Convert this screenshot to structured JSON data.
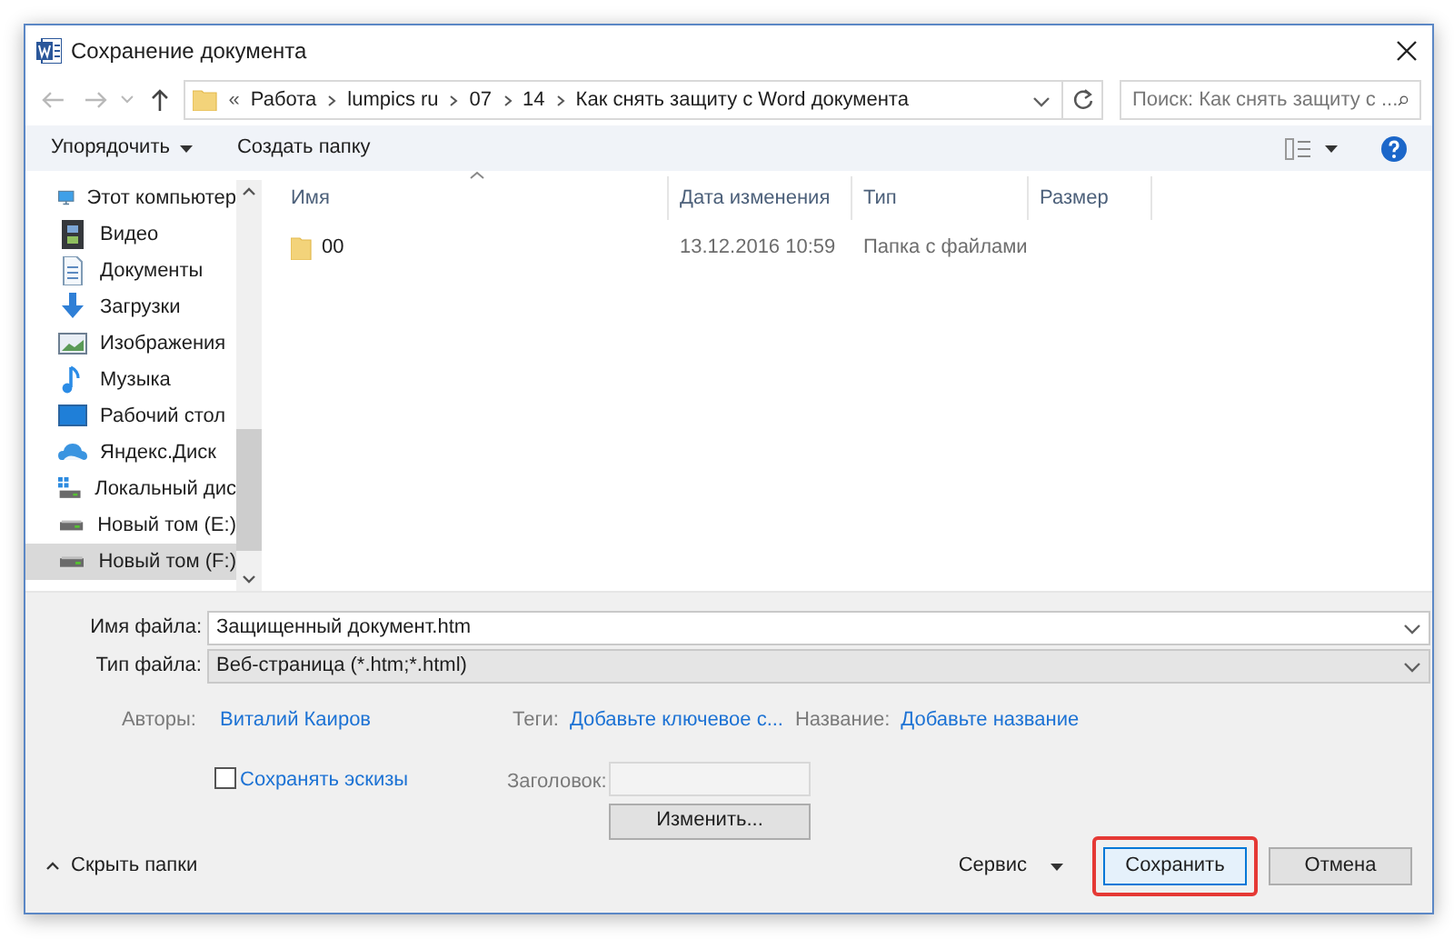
{
  "window": {
    "title": "Сохранение документа"
  },
  "address": {
    "prefix": "«",
    "segments": [
      "Работа",
      "lumpics ru",
      "07",
      "14",
      "Как снять защиту с Word документа"
    ]
  },
  "search": {
    "placeholder": "Поиск: Как снять защиту с ..."
  },
  "toolbar": {
    "organize": "Упорядочить",
    "new_folder": "Создать папку"
  },
  "sidebar": {
    "items": [
      {
        "label": "Этот компьютер",
        "kind": "computer",
        "selected": false
      },
      {
        "label": "Видео",
        "kind": "video",
        "selected": false
      },
      {
        "label": "Документы",
        "kind": "documents",
        "selected": false
      },
      {
        "label": "Загрузки",
        "kind": "downloads",
        "selected": false
      },
      {
        "label": "Изображения",
        "kind": "pictures",
        "selected": false
      },
      {
        "label": "Музыка",
        "kind": "music",
        "selected": false
      },
      {
        "label": "Рабочий стол",
        "kind": "desktop",
        "selected": false
      },
      {
        "label": "Яндекс.Диск",
        "kind": "cloud",
        "selected": false
      },
      {
        "label": "Локальный дис",
        "kind": "system_drive",
        "selected": false
      },
      {
        "label": "Новый том (E:)",
        "kind": "drive",
        "selected": false
      },
      {
        "label": "Новый том (F:)",
        "kind": "drive",
        "selected": true
      }
    ]
  },
  "table": {
    "columns": [
      "Имя",
      "Дата изменения",
      "Тип",
      "Размер"
    ],
    "rows": [
      {
        "name": "00",
        "date": "13.12.2016 10:59",
        "type": "Папка с файлами"
      }
    ]
  },
  "form": {
    "file_name": {
      "label": "Имя файла:",
      "value": "Защищенный документ.htm"
    },
    "file_type": {
      "label": "Тип файла:",
      "value": "Веб-страница (*.htm;*.html)"
    },
    "authors": {
      "label": "Авторы:",
      "value": "Виталий Каиров"
    },
    "tags": {
      "label": "Теги:",
      "value": "Добавьте ключевое с..."
    },
    "title_meta": {
      "label": "Название:",
      "value": "Добавьте название"
    },
    "thumbnails": {
      "label": "Сохранять эскизы",
      "checked": false
    },
    "heading": {
      "label": "Заголовок:"
    },
    "change_button": "Изменить..."
  },
  "footer": {
    "hide_folders": "Скрыть папки",
    "tools": "Сервис",
    "buttons": [
      {
        "label": "Сохранить",
        "default": true,
        "highlighted": true
      },
      {
        "label": "Отмена",
        "default": false,
        "highlighted": false
      }
    ]
  }
}
